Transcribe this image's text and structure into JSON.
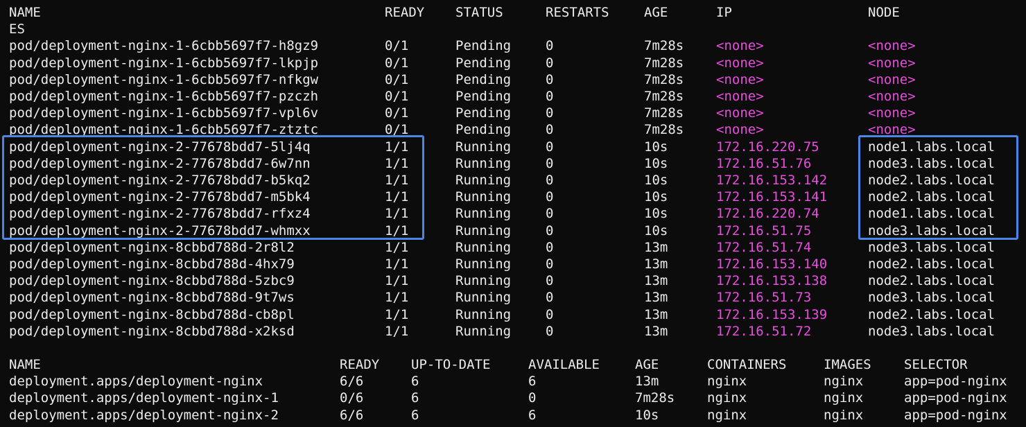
{
  "pods": {
    "headers": [
      "NAME",
      "READY",
      "STATUS",
      "RESTARTS",
      "AGE",
      "IP",
      "NODE"
    ],
    "wrapped_header_tail": "ES",
    "rows": [
      [
        "pod/deployment-nginx-1-6cbb5697f7-h8gz9",
        "0/1",
        "Pending",
        "0",
        "7m28s",
        "<none>",
        "<none>"
      ],
      [
        "pod/deployment-nginx-1-6cbb5697f7-lkpjp",
        "0/1",
        "Pending",
        "0",
        "7m28s",
        "<none>",
        "<none>"
      ],
      [
        "pod/deployment-nginx-1-6cbb5697f7-nfkgw",
        "0/1",
        "Pending",
        "0",
        "7m28s",
        "<none>",
        "<none>"
      ],
      [
        "pod/deployment-nginx-1-6cbb5697f7-pzczh",
        "0/1",
        "Pending",
        "0",
        "7m28s",
        "<none>",
        "<none>"
      ],
      [
        "pod/deployment-nginx-1-6cbb5697f7-vpl6v",
        "0/1",
        "Pending",
        "0",
        "7m28s",
        "<none>",
        "<none>"
      ],
      [
        "pod/deployment-nginx-1-6cbb5697f7-ztztc",
        "0/1",
        "Pending",
        "0",
        "7m28s",
        "<none>",
        "<none>"
      ],
      [
        "pod/deployment-nginx-2-77678bdd7-5lj4q",
        "1/1",
        "Running",
        "0",
        "10s",
        "172.16.220.75",
        "node1.labs.local"
      ],
      [
        "pod/deployment-nginx-2-77678bdd7-6w7nn",
        "1/1",
        "Running",
        "0",
        "10s",
        "172.16.51.76",
        "node3.labs.local"
      ],
      [
        "pod/deployment-nginx-2-77678bdd7-b5kq2",
        "1/1",
        "Running",
        "0",
        "10s",
        "172.16.153.142",
        "node2.labs.local"
      ],
      [
        "pod/deployment-nginx-2-77678bdd7-m5bk4",
        "1/1",
        "Running",
        "0",
        "10s",
        "172.16.153.141",
        "node2.labs.local"
      ],
      [
        "pod/deployment-nginx-2-77678bdd7-rfxz4",
        "1/1",
        "Running",
        "0",
        "10s",
        "172.16.220.74",
        "node1.labs.local"
      ],
      [
        "pod/deployment-nginx-2-77678bdd7-whmxx",
        "1/1",
        "Running",
        "0",
        "10s",
        "172.16.51.75",
        "node3.labs.local"
      ],
      [
        "pod/deployment-nginx-8cbbd788d-2r8l2",
        "1/1",
        "Running",
        "0",
        "13m",
        "172.16.51.74",
        "node3.labs.local"
      ],
      [
        "pod/deployment-nginx-8cbbd788d-4hx79",
        "1/1",
        "Running",
        "0",
        "13m",
        "172.16.153.140",
        "node2.labs.local"
      ],
      [
        "pod/deployment-nginx-8cbbd788d-5zbc9",
        "1/1",
        "Running",
        "0",
        "13m",
        "172.16.153.138",
        "node2.labs.local"
      ],
      [
        "pod/deployment-nginx-8cbbd788d-9t7ws",
        "1/1",
        "Running",
        "0",
        "13m",
        "172.16.51.73",
        "node3.labs.local"
      ],
      [
        "pod/deployment-nginx-8cbbd788d-cb8pl",
        "1/1",
        "Running",
        "0",
        "13m",
        "172.16.153.139",
        "node2.labs.local"
      ],
      [
        "pod/deployment-nginx-8cbbd788d-x2ksd",
        "1/1",
        "Running",
        "0",
        "13m",
        "172.16.51.72",
        "node3.labs.local"
      ]
    ]
  },
  "deployments": {
    "headers": [
      "NAME",
      "READY",
      "UP-TO-DATE",
      "AVAILABLE",
      "AGE",
      "CONTAINERS",
      "IMAGES",
      "SELECTOR"
    ],
    "rows": [
      [
        "deployment.apps/deployment-nginx",
        "6/6",
        "6",
        "6",
        "13m",
        "nginx",
        "nginx",
        "app=pod-nginx"
      ],
      [
        "deployment.apps/deployment-nginx-1",
        "0/6",
        "6",
        "0",
        "7m28s",
        "nginx",
        "nginx",
        "app=pod-nginx"
      ],
      [
        "deployment.apps/deployment-nginx-2",
        "6/6",
        "6",
        "6",
        "10s",
        "nginx",
        "nginx",
        "app=pod-nginx"
      ]
    ]
  },
  "colors": {
    "background": "#0c0c0c",
    "foreground": "#ececec",
    "ip_node_accent": "#ea4cdf",
    "highlight_border": "#4a86e8"
  }
}
